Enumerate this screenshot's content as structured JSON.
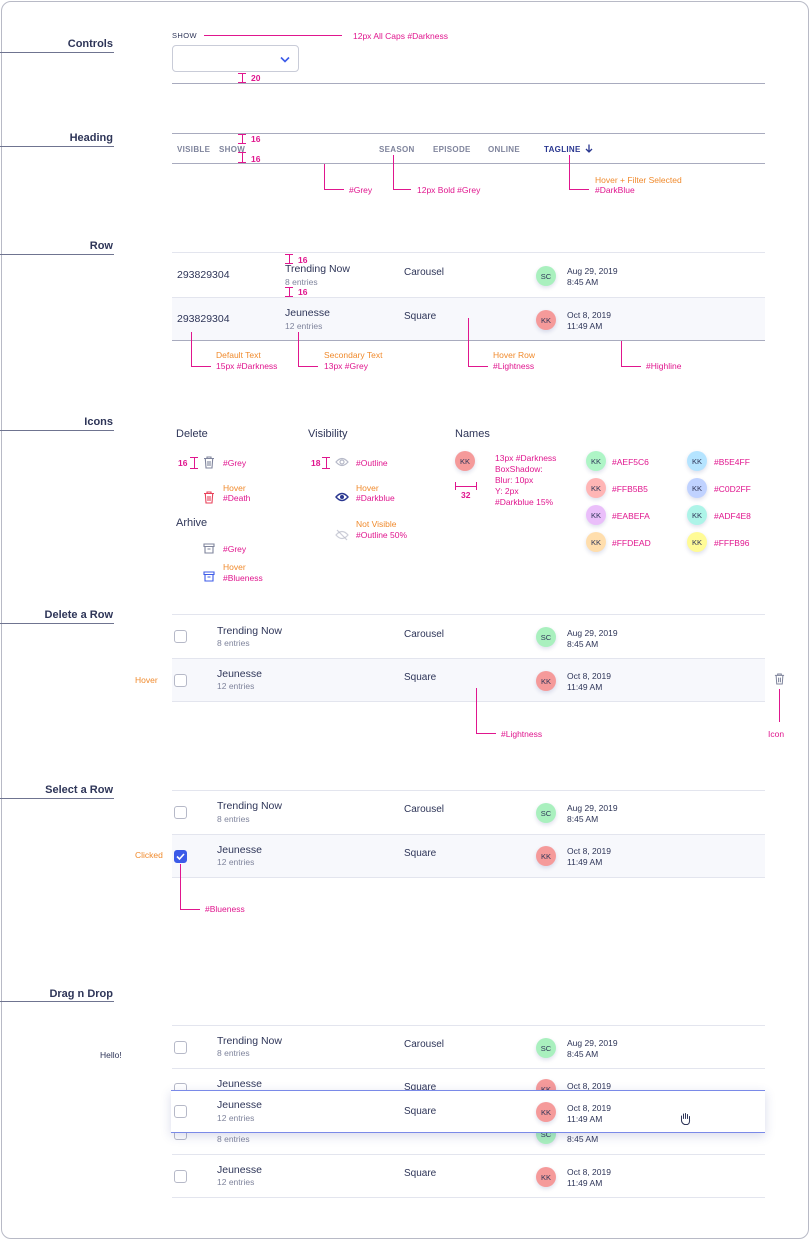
{
  "sections": {
    "controls": "Controls",
    "heading": "Heading",
    "row": "Row",
    "icons": "Icons",
    "delete_row": "Delete a Row",
    "select_row": "Select a Row",
    "drag_drop": "Drag n Drop"
  },
  "controls": {
    "show_label": "SHOW",
    "show_note": "12px All Caps #Darkness",
    "gap": "20"
  },
  "heading": {
    "columns": [
      "VISIBLE",
      "SHOW",
      "SEASON",
      "EPISODE",
      "ONLINE",
      "TAGLINE"
    ],
    "gap_top": "16",
    "gap_bottom": "16",
    "note_grey": "#Grey",
    "note_bold": "12px Bold #Grey",
    "note_hover": "Hover + Filter Selected",
    "note_darkblue": "#DarkBlue"
  },
  "row_spec": {
    "gap_top": "16",
    "gap_bottom": "16",
    "note_default_1": "Default Text",
    "note_default_2": "15px #Darkness",
    "note_secondary_1": "Secondary Text",
    "note_secondary_2": "13px #Grey",
    "note_hover_1": "Hover Row",
    "note_hover_2": "#Lightness",
    "note_highline": "#Highline"
  },
  "rows": [
    {
      "id": "293829304",
      "title": "Trending Now",
      "entries": "8 entries",
      "season": "Carousel",
      "initials": "SC",
      "avatar_color": "#A9F0BE",
      "date": "Aug 29, 2019",
      "time": "8:45 AM"
    },
    {
      "id": "293829304",
      "title": "Jeunesse",
      "entries": "12 entries",
      "season": "Square",
      "initials": "KK",
      "avatar_color": "#F59A9A",
      "date": "Oct 8, 2019",
      "time": "11:49 AM"
    }
  ],
  "icons": {
    "delete": {
      "title": "Delete",
      "size": "16",
      "grey": "#Grey",
      "hover": "Hover",
      "death": "#Death"
    },
    "archive": {
      "title": "Arhive",
      "grey": "#Grey",
      "hover": "Hover",
      "blueness": "#Blueness"
    },
    "visibility": {
      "title": "Visibility",
      "size": "18",
      "outline": "#Outline",
      "hover": "Hover",
      "darkblue": "#Darkblue",
      "not_visible": "Not Visible",
      "outline50": "#Outline 50%"
    },
    "names": {
      "title": "Names",
      "initials": "KK",
      "spec": [
        "13px #Darkness",
        "BoxShadow:",
        "Blur: 10px",
        "Y: 2px",
        "#Darkblue 15%"
      ],
      "size": "32",
      "swatches": [
        {
          "initials": "KK",
          "color": "#AEF5C6",
          "label": "#AEF5C6"
        },
        {
          "initials": "KK",
          "color": "#B5E4FF",
          "label": "#B5E4FF"
        },
        {
          "initials": "KK",
          "color": "#FFB5B5",
          "label": "#FFB5B5"
        },
        {
          "initials": "KK",
          "color": "#C0D2FF",
          "label": "#C0D2FF"
        },
        {
          "initials": "KK",
          "color": "#EABEFA",
          "label": "#EABEFA"
        },
        {
          "initials": "KK",
          "color": "#ADF4E8",
          "label": "#ADF4E8"
        },
        {
          "initials": "KK",
          "color": "#FFDEAD",
          "label": "#FFDEAD"
        },
        {
          "initials": "KK",
          "color": "#FFFB96",
          "label": "#FFFB96"
        }
      ]
    }
  },
  "delete_row": {
    "hover_label": "Hover",
    "lightness": "#Lightness",
    "icon_label": "Icon"
  },
  "select_row": {
    "clicked_label": "Clicked",
    "blueness": "#Blueness"
  },
  "drag_drop": {
    "hello": "Hello!",
    "under_title": "Jeunesse",
    "under_season": "Square",
    "under_date": "Oct 8, 2019",
    "under_entries": "8 entries",
    "under_time": "8:45 AM"
  },
  "colors": {
    "annotation": "#E0168E",
    "annotation_orange": "#F08A2C",
    "darkness": "#2E3558",
    "grey": "#7F849C",
    "darkblue": "#2A3790",
    "blueness": "#3C5BE8",
    "death": "#E8415A",
    "lightness": "#F7F8FC"
  }
}
